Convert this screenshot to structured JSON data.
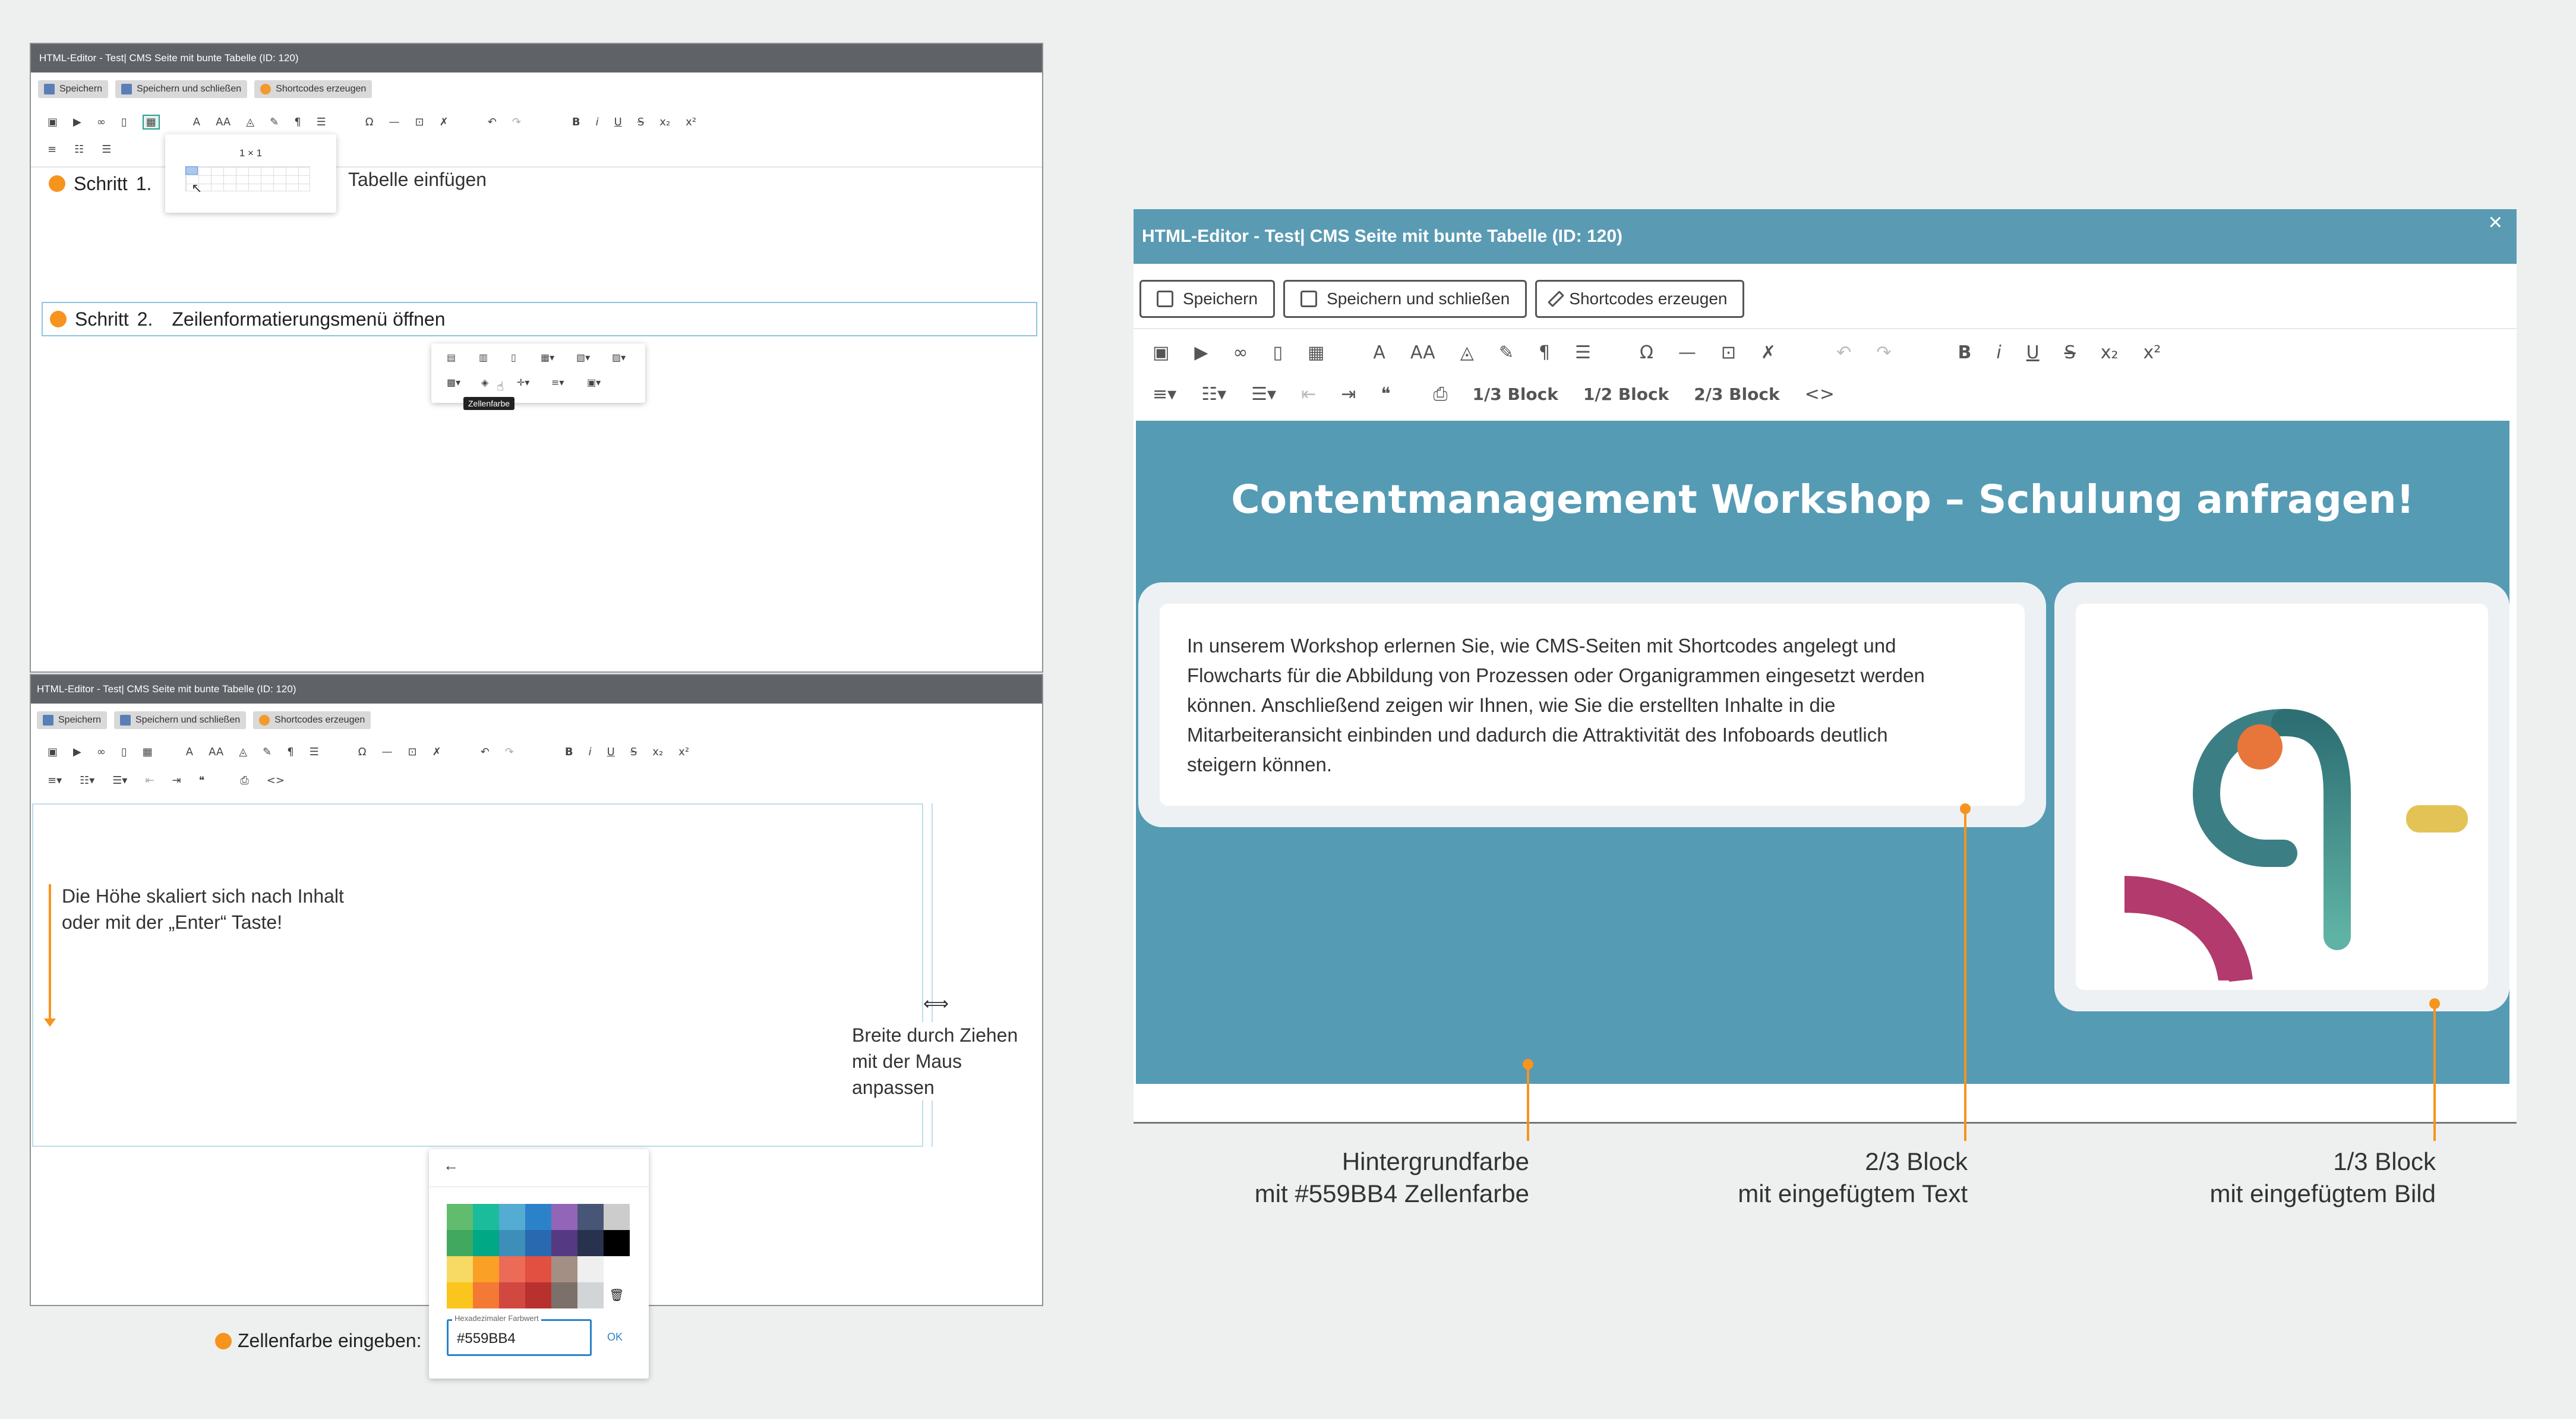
{
  "editor_title": "HTML-Editor - Test| CMS Seite mit bunte Tabelle (ID: 120)",
  "buttons": {
    "save": "Speichern",
    "save_close": "Speichern und schließen",
    "shortcodes": "Shortcodes erzeugen"
  },
  "toolbar_icons": [
    "image-icon",
    "video-icon",
    "link-icon",
    "file-icon",
    "table-icon",
    "font-color-icon",
    "font-size-icon",
    "background-color-icon",
    "eraser-icon",
    "paragraph-icon",
    "line-height-icon",
    "special-char-icon",
    "horizontal-rule-icon",
    "select-all-icon",
    "clear-format-icon",
    "undo-icon",
    "redo-icon",
    "bold-icon",
    "italic-icon",
    "underline-icon",
    "strikethrough-icon",
    "subscript-icon",
    "superscript-icon"
  ],
  "toolbar_glyphs": {
    "font": "A",
    "font_size": "AA",
    "paragraph": "¶",
    "omega": "Ω",
    "dash": "—",
    "bold": "B",
    "italic": "i",
    "underline": "U",
    "strike": "S",
    "sub": "x₂",
    "sup": "x²",
    "undo": "↶",
    "redo": "↷",
    "quote": "❝",
    "code": "<>"
  },
  "block_buttons": {
    "one_third": "1/3 Block",
    "half": "1/2 Block",
    "two_third": "2/3 Block"
  },
  "step1": {
    "label": "Schritt",
    "num": "1.",
    "text": "Tabelle einfügen"
  },
  "step2": {
    "label": "Schritt",
    "num": "2.",
    "text": "Zeilenformatierungsmenü öffnen"
  },
  "table_picker_size": "1 × 1",
  "tooltip": "Zellenfarbe",
  "height_note_line1": "Die Höhe skaliert sich nach Inhalt",
  "height_note_line2": "oder mit der „Enter“ Taste!",
  "width_note_line1": "Breite durch Ziehen",
  "width_note_line2": "mit der Maus anpassen",
  "color_picker": {
    "back": "←",
    "hex_label": "Hexadezimaler Farbwert",
    "hex_value": "#559BB4",
    "ok": "OK",
    "colors": [
      "#61bd6d",
      "#1abc9c",
      "#54acd2",
      "#2c82c9",
      "#9365b8",
      "#475577",
      "#cccccc",
      "#41a85f",
      "#00a885",
      "#3d8eb9",
      "#2969b0",
      "#553982",
      "#28324e",
      "#000000",
      "#f7da64",
      "#fba026",
      "#eb6b56",
      "#e25041",
      "#a38f84",
      "#efefef",
      "#ffffff",
      "#fac51c",
      "#f37934",
      "#d14841",
      "#b8312f",
      "#7c706b",
      "#d1d5d8",
      "#trash"
    ]
  },
  "zellenfarbe_prompt": "Zellenfarbe eingeben:",
  "content": {
    "heading": "Contentmanagement Workshop – Schulung anfragen!",
    "paragraph_lines": [
      "In unserem Workshop erlernen Sie, wie CMS-Seiten mit Shortcodes angelegt und",
      "Flowcharts für die Abbildung von Prozessen oder Organigrammen eingesetzt werden",
      "können. Anschließend zeigen wir Ihnen, wie Sie die erstellten Inhalte in die",
      "Mitarbeiteransicht einbinden und dadurch die Attraktivität des Infoboards deutlich",
      "steigern können."
    ],
    "bg_color": "#559BB4"
  },
  "annotations": {
    "bg": {
      "line1": "Hintergrundfarbe",
      "line2": "mit #559BB4  Zellenfarbe"
    },
    "two_third": {
      "line1": "2/3 Block",
      "line2": "mit eingefügtem Text"
    },
    "one_third": {
      "line1": "1/3 Block",
      "line2": "mit eingefügtem Bild"
    }
  },
  "close_glyph": "×",
  "accent_orange": "#F7941D",
  "title_bar_gray": "#5F6367"
}
